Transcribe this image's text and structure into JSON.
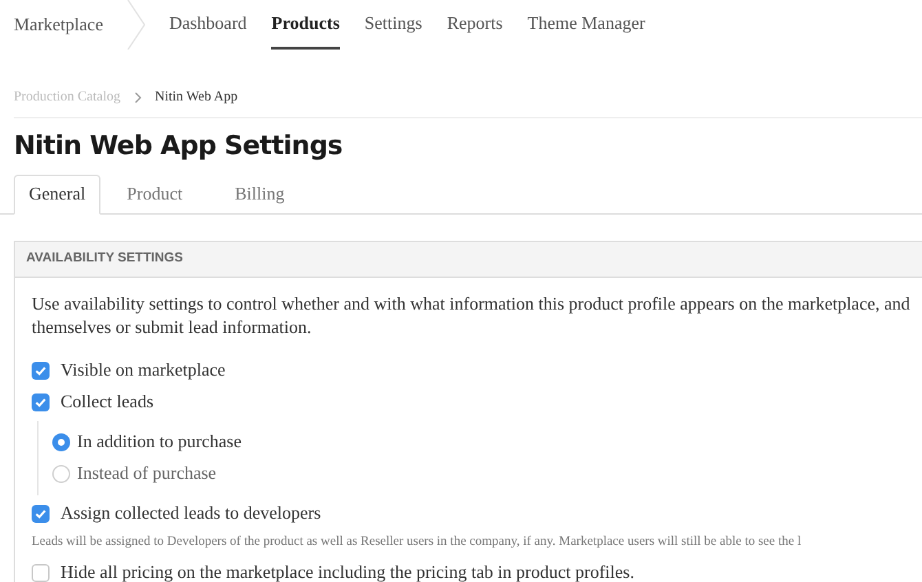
{
  "nav": {
    "brand": "Marketplace",
    "items": [
      {
        "label": "Dashboard",
        "selected": false
      },
      {
        "label": "Products",
        "selected": true
      },
      {
        "label": "Settings",
        "selected": false
      },
      {
        "label": "Reports",
        "selected": false
      },
      {
        "label": "Theme Manager",
        "selected": false
      }
    ]
  },
  "breadcrumb": [
    {
      "label": "Production Catalog"
    },
    {
      "label": "Nitin Web App"
    }
  ],
  "title": "Nitin Web App Settings",
  "tabs": [
    {
      "label": "General",
      "selected": true
    },
    {
      "label": "Product",
      "selected": false
    },
    {
      "label": "Billing",
      "selected": false
    }
  ],
  "panel": {
    "header": "AVAILABILITY SETTINGS",
    "description": "Use availability settings to control whether and with what information this product profile appears on the marketplace, and themselves or submit lead information.",
    "options": [
      {
        "kind": "checkbox",
        "label": "Visible on marketplace",
        "checked": true
      },
      {
        "kind": "checkbox",
        "label": "Collect leads",
        "checked": true
      },
      {
        "kind": "radios",
        "items": [
          {
            "label": "In addition to purchase",
            "selected": true
          },
          {
            "label": "Instead of purchase",
            "selected": false
          }
        ]
      },
      {
        "kind": "checkbox",
        "label": "Assign collected leads to developers",
        "checked": true
      },
      {
        "kind": "note",
        "label": "Leads will be assigned to Developers of the product as well as Reseller users in the company, if any. Marketplace users will still be able to see the l"
      },
      {
        "kind": "checkbox",
        "label": "Hide all pricing on the marketplace including the pricing tab in product profiles.",
        "checked": false
      }
    ]
  }
}
